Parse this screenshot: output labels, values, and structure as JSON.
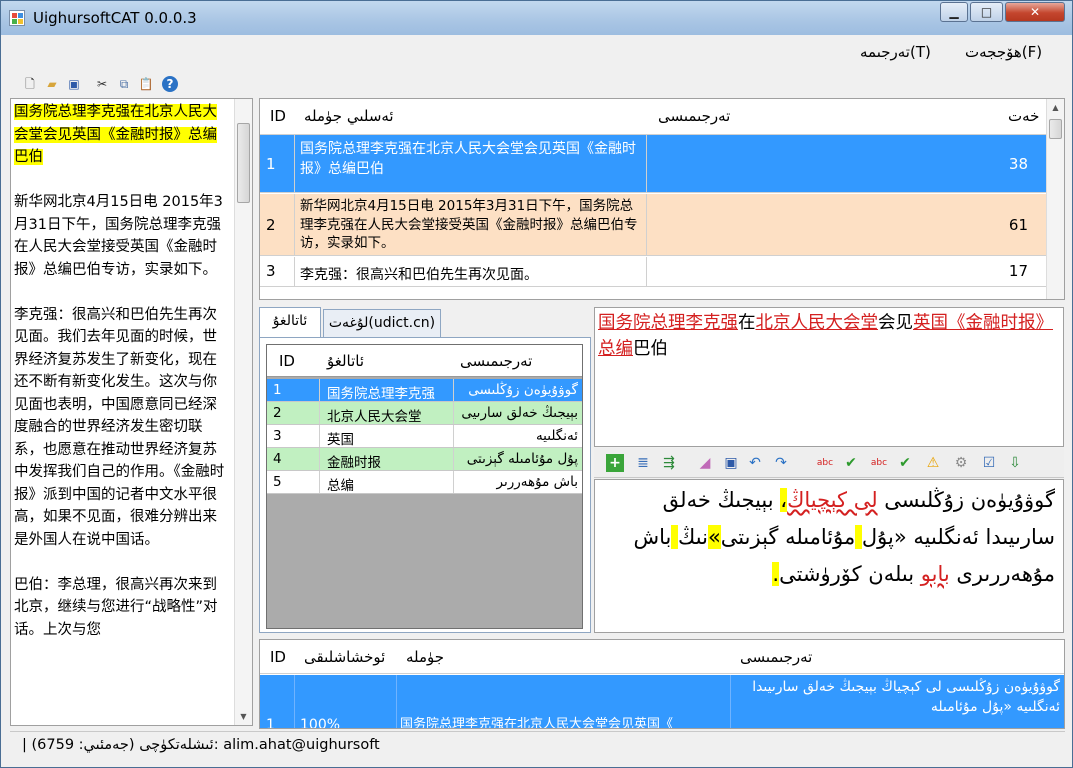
{
  "window": {
    "title": "UighursoftCAT 0.0.0.3",
    "minimize": "▁",
    "maximize": "□",
    "close": "✕"
  },
  "menu": {
    "file": "ھۆججەت(F)",
    "translate": "تەرجىمە(T)"
  },
  "left_text_highlight": "国务院总理李克强在北京人民大会堂会见英国《金融时报》总编巴伯",
  "left_text_body": "\n\n新华网北京4月15日电 2015年3月31日下午，国务院总理李克强在人民大会堂接受英国《金融时报》总编巴伯专访，实录如下。\n\n李克强：很高兴和巴伯先生再次见面。我们去年见面的时候，世界经济复苏发生了新变化，现在还不断有新变化发生。这次与你见面也表明，中国愿意同已经深度融合的世界经济发生密切联系，也愿意在推动世界经济复苏中发挥我们自己的作用。《金融时报》派到中国的记者中文水平很高，如果不见面，很难分辨出来是外国人在说中国话。\n\n巴伯：李总理，很高兴再次来到北京，继续与您进行“战略性”对话。上次与您",
  "sentence_grid": {
    "headers": {
      "id": "ID",
      "source": "ئەسلىي جۈملە",
      "target": "تەرجىمىسى",
      "chars": "خەت"
    },
    "rows": [
      {
        "id": "1",
        "source": "国务院总理李克强在北京人民大会堂会见英国《金融时报》总编巴伯",
        "target": "",
        "chars": "38"
      },
      {
        "id": "2",
        "source": "新华网北京4月15日电 2015年3月31日下午，国务院总理李克强在人民大会堂接受英国《金融时报》总编巴伯专访，实录如下。",
        "target": "",
        "chars": "61"
      },
      {
        "id": "3",
        "source": "李克强：很高兴和巴伯先生再次见面。",
        "target": "",
        "chars": "17"
      }
    ]
  },
  "tabs": {
    "terms": "ئاتالغۇ",
    "dict": "لۇغەت(udict.cn)"
  },
  "term_grid": {
    "headers": {
      "id": "ID",
      "term": "ئاتالغۇ",
      "translation": "تەرجىمىسى"
    },
    "rows": [
      {
        "id": "1",
        "term": "国务院总理李克强",
        "translation": "گوۋۇيۈەن زۇڭلىسى"
      },
      {
        "id": "2",
        "term": "北京人民大会堂",
        "translation": "بېيجىڭ خەلق سارىيى"
      },
      {
        "id": "3",
        "term": "英国",
        "translation": "ئەنگلىيە"
      },
      {
        "id": "4",
        "term": "金融时报",
        "translation": "پۇل مۇئامىلە گېزىتى"
      },
      {
        "id": "5",
        "term": "总编",
        "translation": "باش مۇھەررىر"
      }
    ]
  },
  "source_segment": {
    "p1": "国务院总理李克强",
    "p2": "在",
    "p3": "北京人民大会堂",
    "p4": "会见",
    "p5": "英国",
    "p6": "《",
    "p7": "金融时报",
    "p8": "》",
    "p9": "总编",
    "p10": "巴伯"
  },
  "target_segment": {
    "t1": "گوۋۇيۈەن زۇڭلىسى ",
    "t2": "لى كېچياڭ",
    "t3": "،",
    "t4": " بېيجىڭ خەلق سارىيىدا ئەنگلىيە «پۇل",
    "t5": " ",
    "t6": "مۇئامىلە گېزىتى",
    "t7": "»",
    "t8": "نىڭ",
    "t9": " ",
    "t10": "باش مۇھەررىرى ",
    "t11": "بابو",
    "t12": " بىلەن كۆرۈشتى",
    "t13": "."
  },
  "tm_grid": {
    "headers": {
      "id": "ID",
      "match": "ئوخشاشلىقى",
      "sentence": "جۈملە",
      "translation": "تەرجىمىسى"
    },
    "row": {
      "id": "1",
      "match": "100%",
      "sentence": "国务院总理李克强在北京人民大会堂会见英国《",
      "translation": "گوۋۇيۈەن زۇڭلىسى لى كېچياڭ بېيجىڭ خەلق سارىيىدا ئەنگلىيە «پۇل مۇئامىلە"
    }
  },
  "status": {
    "text": "| (جەمئىي: 6759) ئىشلەتكۈچى: alim.ahat@uighursoft"
  },
  "colors": {
    "selected_row": "#3399ff",
    "row_alt": "#fde0c4",
    "term_green": "#c1f0c1",
    "highlight": "#ffff00",
    "term_red": "#d42020"
  }
}
